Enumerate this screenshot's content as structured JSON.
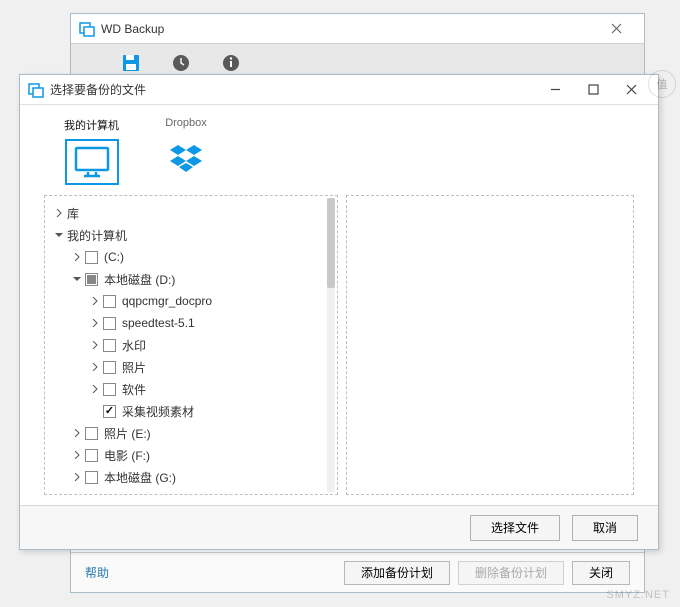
{
  "parent": {
    "title": "WD Backup",
    "help": "帮助",
    "add_plan": "添加备份计划",
    "delete_plan": "删除备份计划",
    "close": "关闭"
  },
  "dialog": {
    "title": "选择要备份的文件",
    "sources": {
      "my_computer": "我的计算机",
      "dropbox": "Dropbox"
    },
    "buttons": {
      "select_files": "选择文件",
      "cancel": "取消"
    }
  },
  "tree": {
    "library": "库",
    "my_computer": "我的计算机",
    "drive_c": "(C:)",
    "drive_d": "本地磁盘 (D:)",
    "d_children": {
      "qqpcmgr": "qqpcmgr_docpro",
      "speedtest": "speedtest-5.1",
      "shuiyin": "水印",
      "zhaopian": "照片",
      "ruanjian": "软件",
      "caiji": "采集视频素材"
    },
    "photos_e": "照片 (E:)",
    "movies_f": "电影 (F:)",
    "drive_g": "本地磁盘 (G:)"
  },
  "watermark": "SMYZ.NET",
  "badge": "值"
}
